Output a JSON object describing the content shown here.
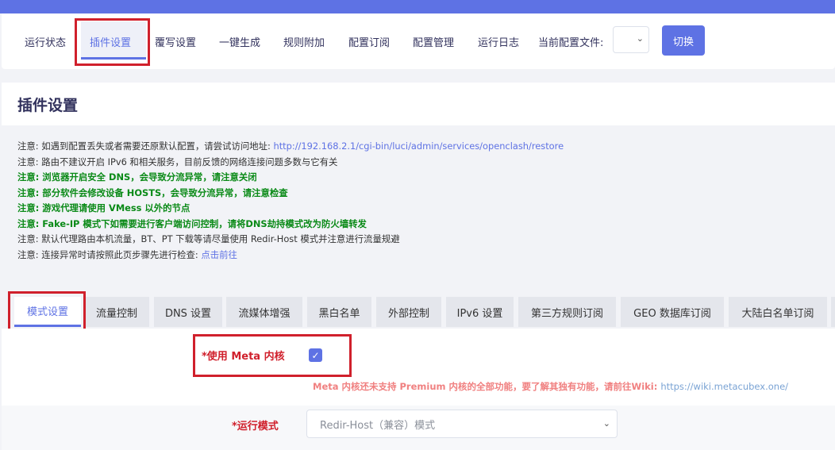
{
  "nav": {
    "items": [
      "运行状态",
      "插件设置",
      "覆写设置",
      "一键生成",
      "规则附加",
      "配置订阅",
      "配置管理",
      "运行日志"
    ],
    "config_label": "当前配置文件:",
    "switch_label": "切换"
  },
  "page_title": "插件设置",
  "notes": {
    "n1_text": "注意: 如遇到配置丢失或者需要还原默认配置，请尝试访问地址: ",
    "n1_link": "http://192.168.2.1/cgi-bin/luci/admin/services/openclash/restore",
    "n2": "注意: 路由不建议开启 IPv6 和相关服务，目前反馈的网络连接问题多数与它有关",
    "n3": "注意: 浏览器开启安全 DNS，会导致分流异常，请注意关闭",
    "n4": "注意: 部分软件会修改设备 HOSTS，会导致分流异常，请注意检查",
    "n5": "注意: 游戏代理请使用 VMess 以外的节点",
    "n6": "注意: Fake-IP 模式下如需要进行客户端访问控制，请将DNS劫持模式改为防火墙转发",
    "n7": "注意: 默认代理路由本机流量，BT、PT 下载等请尽量使用 Redir-Host 模式并注意进行流量规避",
    "n8_text": "注意: 连接异常时请按照此页步骤先进行检查: ",
    "n8_link": "点击前往"
  },
  "tabs": [
    "模式设置",
    "流量控制",
    "DNS 设置",
    "流媒体增强",
    "黑白名单",
    "外部控制",
    "IPv6 设置",
    "第三方规则订阅",
    "GEO 数据库订阅",
    "大陆白名单订阅"
  ],
  "form": {
    "meta_label": "*使用 Meta 内核",
    "meta_checked": true,
    "meta_hint": "Meta 内核还未支持 Premium 内核的全部功能，要了解其独有功能，请前往Wiki: ",
    "meta_hint_url": "https://wiki.metacubex.one/",
    "mode_label": "*运行模式",
    "mode_value": "Redir-Host（兼容）模式"
  },
  "colors": {
    "accent": "#5e72e4",
    "highlight": "#d0202c",
    "note_green": "#0a8a17"
  }
}
